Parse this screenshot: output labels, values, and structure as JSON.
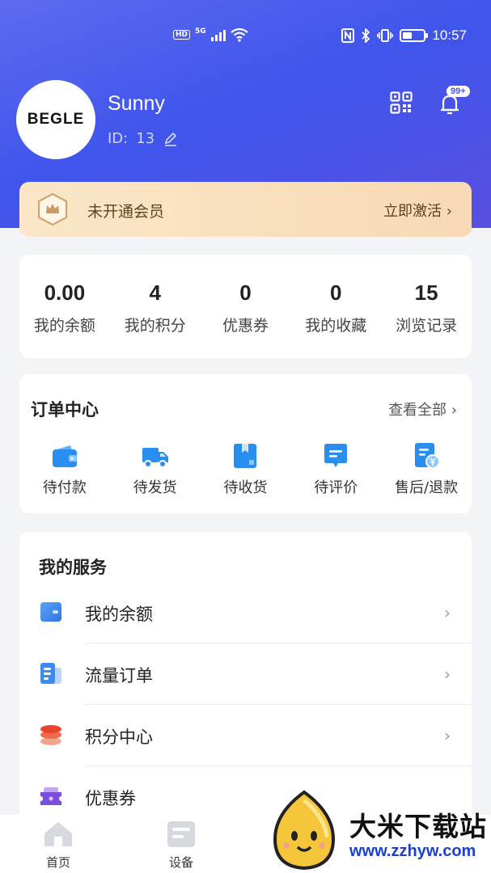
{
  "status_bar": {
    "network": "5G",
    "hd": "HD",
    "time": "10:57"
  },
  "profile": {
    "avatar_text": "BEGLE",
    "name": "Sunny",
    "id_label": "ID:",
    "id_value": "13",
    "notification_badge": "99+"
  },
  "vip": {
    "status": "未开通会员",
    "action": "立即激活"
  },
  "stats": [
    {
      "value": "0.00",
      "label": "我的余额"
    },
    {
      "value": "4",
      "label": "我的积分"
    },
    {
      "value": "0",
      "label": "优惠券"
    },
    {
      "value": "0",
      "label": "我的收藏"
    },
    {
      "value": "15",
      "label": "浏览记录"
    }
  ],
  "orders": {
    "title": "订单中心",
    "see_all": "查看全部",
    "items": [
      {
        "label": "待付款",
        "icon": "wallet-icon"
      },
      {
        "label": "待发货",
        "icon": "truck-icon"
      },
      {
        "label": "待收货",
        "icon": "package-icon"
      },
      {
        "label": "待评价",
        "icon": "comment-icon"
      },
      {
        "label": "售后/退款",
        "icon": "refund-icon"
      }
    ]
  },
  "services": {
    "title": "我的服务",
    "items": [
      {
        "label": "我的余额",
        "icon": "card-icon"
      },
      {
        "label": "流量订单",
        "icon": "document-icon"
      },
      {
        "label": "积分中心",
        "icon": "coins-icon"
      },
      {
        "label": "优惠券",
        "icon": "ticket-icon"
      }
    ]
  },
  "tabbar": {
    "items": [
      {
        "label": "首页",
        "icon": "home-icon"
      },
      {
        "label": "设备",
        "icon": "device-icon"
      }
    ]
  },
  "watermark": {
    "brand": "大米下载站",
    "url": "www.zzhyw.com"
  },
  "colors": {
    "header_primary": "#4a55ee",
    "accent_blue": "#2a8df0",
    "vip_bg": "#f7dab3",
    "vip_text": "#5d4321"
  }
}
